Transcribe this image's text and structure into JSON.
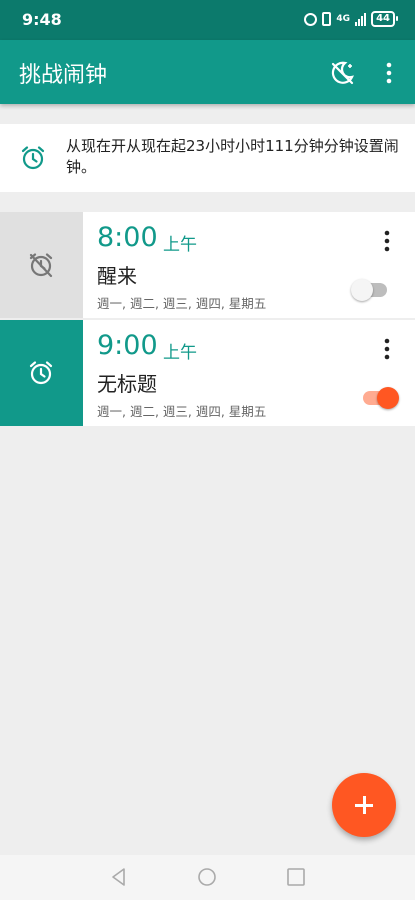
{
  "status_bar": {
    "time": "9:48",
    "network": "4G",
    "battery": "44",
    "icons": [
      "alarm-icon",
      "vibrate-icon",
      "signal-icon",
      "battery-icon"
    ]
  },
  "app_bar": {
    "title": "挑战闹钟",
    "actions": [
      "night-mode-icon",
      "more-vert-icon"
    ]
  },
  "info_banner": {
    "text": "从现在开从现在起23小时小时111分钟分钟设置闹钟。",
    "icon": "alarm-icon"
  },
  "alarms": [
    {
      "time": "8:00",
      "ampm": "上午",
      "label": "醒来",
      "days": "週一, 週二, 週三, 週四, 星期五",
      "enabled": false,
      "icon": "alarm-off-icon"
    },
    {
      "time": "9:00",
      "ampm": "上午",
      "label": "无标题",
      "days": "週一, 週二, 週三, 週四, 星期五",
      "enabled": true,
      "icon": "alarm-icon"
    }
  ],
  "colors": {
    "status_bar": "#0c7a6c",
    "primary": "#11998a",
    "accent": "#ff5722",
    "disabled_tile": "#e0e0e0"
  },
  "fab": {
    "icon": "plus-icon"
  },
  "nav_bar": {
    "icons": [
      "back-icon",
      "home-icon",
      "recents-icon"
    ]
  }
}
